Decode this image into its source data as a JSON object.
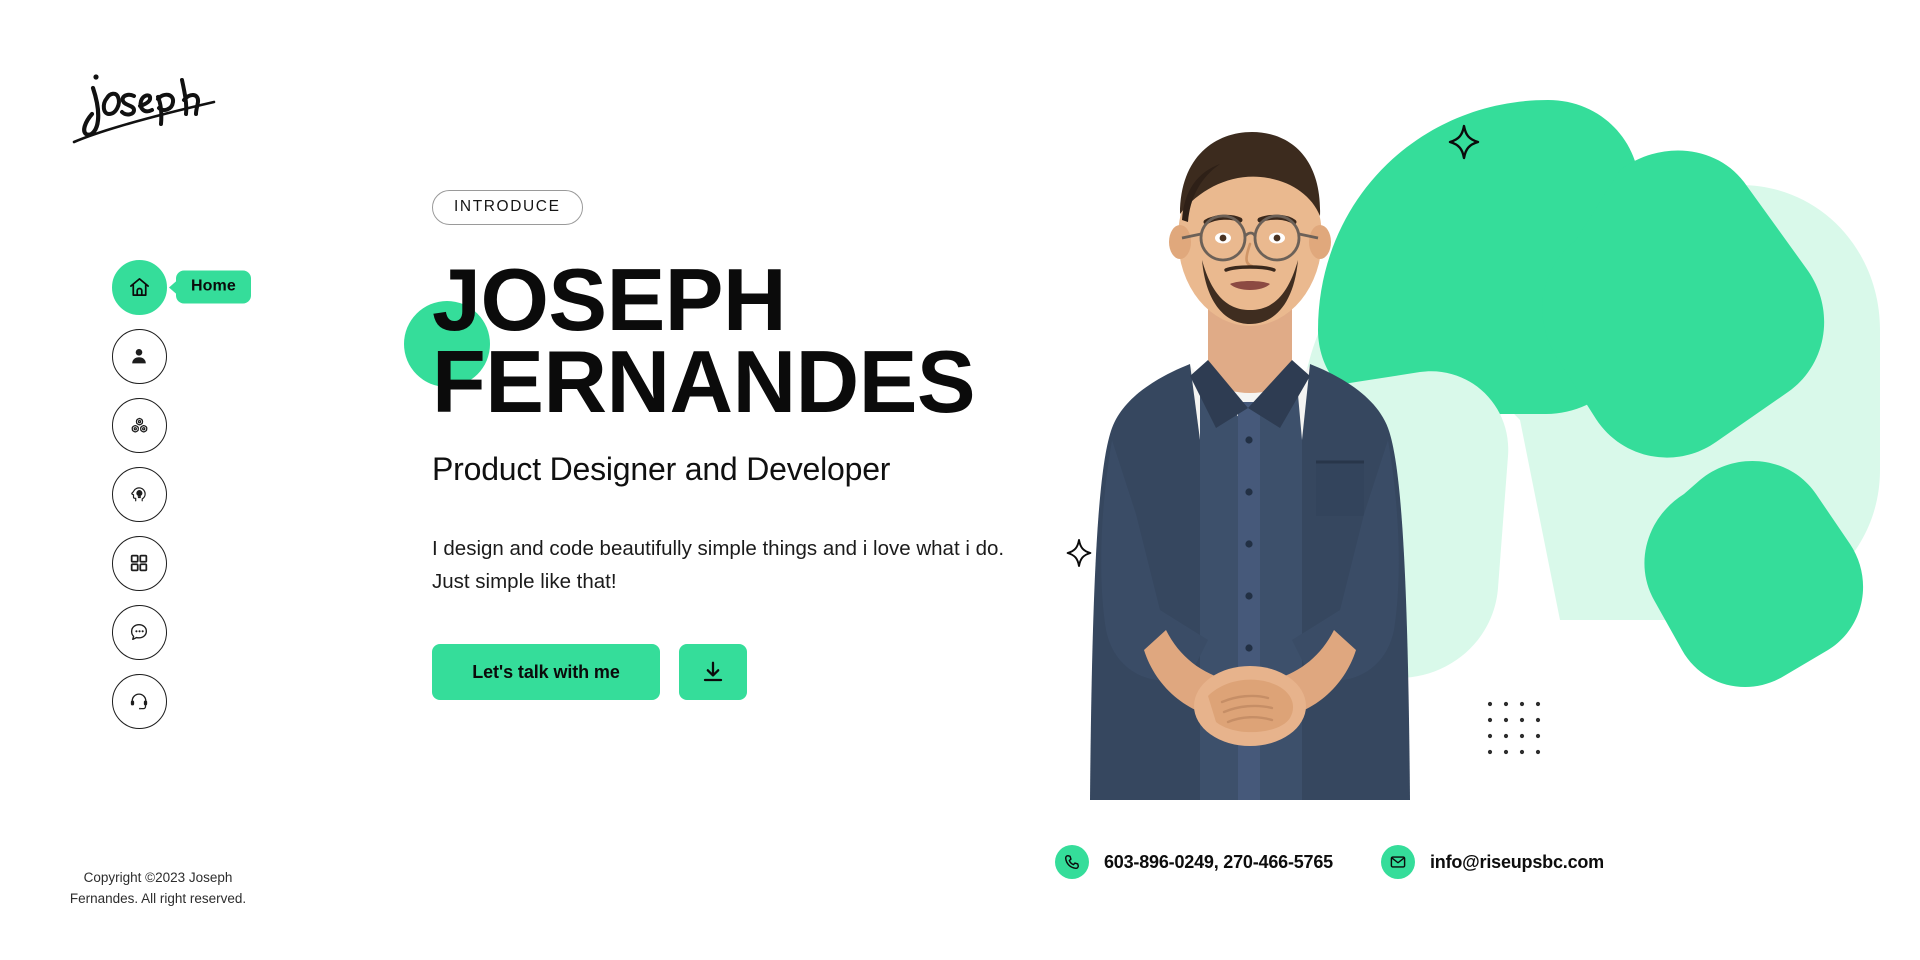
{
  "brand": {
    "logo_text": "joseph",
    "logo_icon": "signature-script-logo"
  },
  "theme": {
    "accent": "#35dd9a",
    "accent_light": "#d9f9ea",
    "text": "#0b0b0b",
    "background": "#ffffff"
  },
  "sidebar": {
    "items": [
      {
        "id": "home",
        "icon": "home-icon",
        "label": "Home",
        "active": true,
        "tooltip": "Home"
      },
      {
        "id": "about",
        "icon": "user-icon",
        "label": "About",
        "active": false,
        "tooltip": ""
      },
      {
        "id": "services",
        "icon": "gears-icon",
        "label": "Services",
        "active": false,
        "tooltip": ""
      },
      {
        "id": "skills",
        "icon": "idea-head-icon",
        "label": "Skills",
        "active": false,
        "tooltip": ""
      },
      {
        "id": "portfolio",
        "icon": "grid-icon",
        "label": "Portfolio",
        "active": false,
        "tooltip": ""
      },
      {
        "id": "blog",
        "icon": "chat-icon",
        "label": "Blog",
        "active": false,
        "tooltip": ""
      },
      {
        "id": "contact",
        "icon": "headset-icon",
        "label": "Contact",
        "active": false,
        "tooltip": ""
      }
    ]
  },
  "hero": {
    "badge": "INTRODUCE",
    "title_line1": "JOSEPH",
    "title_line2": "FERNANDES",
    "subtitle": "Product Designer and Developer",
    "description": "I design and code beautifully simple things and i love what i do. Just simple like that!",
    "primary_button": "Let's talk with me",
    "download_button_icon": "download-icon",
    "sparkle_icon": "sparkle-icon"
  },
  "footer": {
    "copyright": "Copyright ©2023 Joseph Fernandes. All right reserved.",
    "contacts": [
      {
        "icon": "phone-icon",
        "value": "603-896-0249, 270-466-5765"
      },
      {
        "icon": "mail-icon",
        "value": "info@riseupsbc.com"
      }
    ]
  },
  "decor": {
    "sparkle_top": "sparkle-icon",
    "dots_grid": "dot-grid-decoration",
    "portrait": "portrait-photo-man-with-glasses"
  }
}
